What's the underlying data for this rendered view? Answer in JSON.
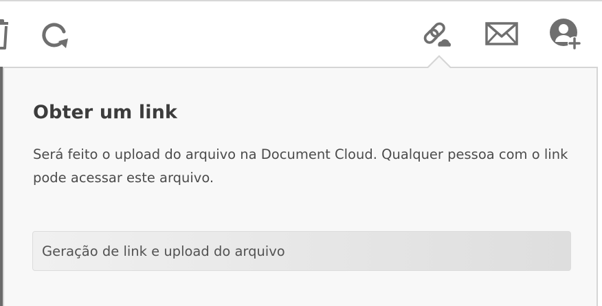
{
  "toolbar": {
    "icons": [
      {
        "name": "trash-icon"
      },
      {
        "name": "redo-icon"
      },
      {
        "name": "get-link-icon"
      },
      {
        "name": "email-icon"
      },
      {
        "name": "add-user-icon"
      }
    ],
    "icon_color": "#6f6f6f"
  },
  "popover": {
    "title": "Obter um link",
    "description": "Será feito o upload do arquivo na Document Cloud. Qualquer pessoa com o link pode acessar este arquivo.",
    "action_label": "Geração de link e upload do arquivo"
  }
}
